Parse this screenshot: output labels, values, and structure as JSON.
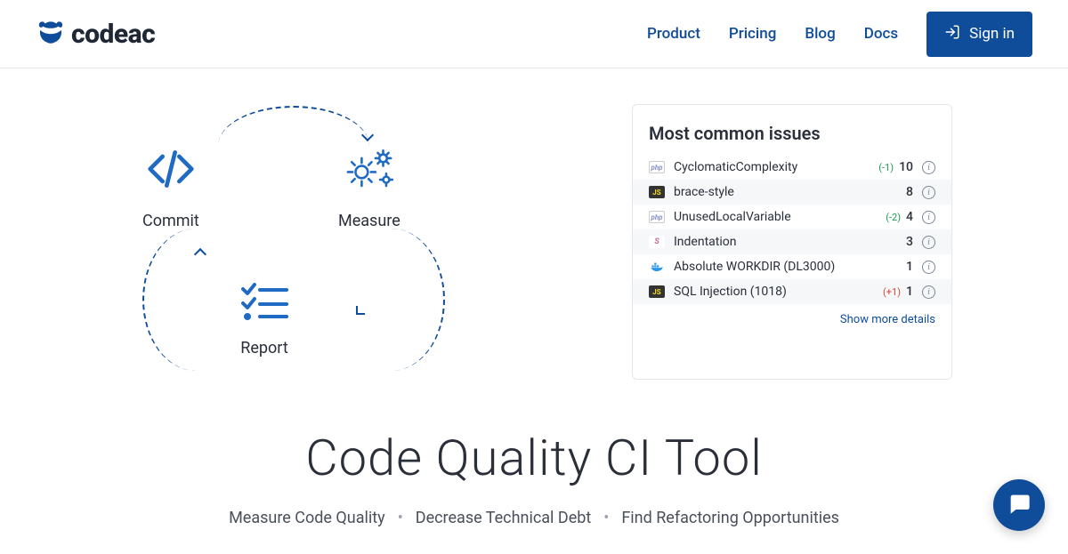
{
  "brand": "codeac",
  "nav": {
    "items": [
      "Product",
      "Pricing",
      "Blog",
      "Docs"
    ],
    "signin": "Sign in"
  },
  "cycle": {
    "commit": "Commit",
    "measure": "Measure",
    "report": "Report"
  },
  "issues": {
    "title": "Most common issues",
    "rows": [
      {
        "tech": "php",
        "name": "CyclomaticComplexity",
        "delta": "(-1)",
        "delta_kind": "green",
        "count": "10"
      },
      {
        "tech": "js",
        "name": "brace-style",
        "delta": "",
        "delta_kind": "",
        "count": "8"
      },
      {
        "tech": "php",
        "name": "UnusedLocalVariable",
        "delta": "(-2)",
        "delta_kind": "green",
        "count": "4"
      },
      {
        "tech": "sass",
        "name": "Indentation",
        "delta": "",
        "delta_kind": "",
        "count": "3"
      },
      {
        "tech": "docker",
        "name": "Absolute WORKDIR (DL3000)",
        "delta": "",
        "delta_kind": "",
        "count": "1"
      },
      {
        "tech": "js",
        "name": "SQL Injection (1018)",
        "delta": "(+1)",
        "delta_kind": "red",
        "count": "1"
      }
    ],
    "show_more": "Show more details"
  },
  "hero": {
    "title": "Code Quality CI Tool",
    "sub": [
      "Measure Code Quality",
      "Decrease Technical Debt",
      "Find Refactoring Opportunities"
    ]
  }
}
